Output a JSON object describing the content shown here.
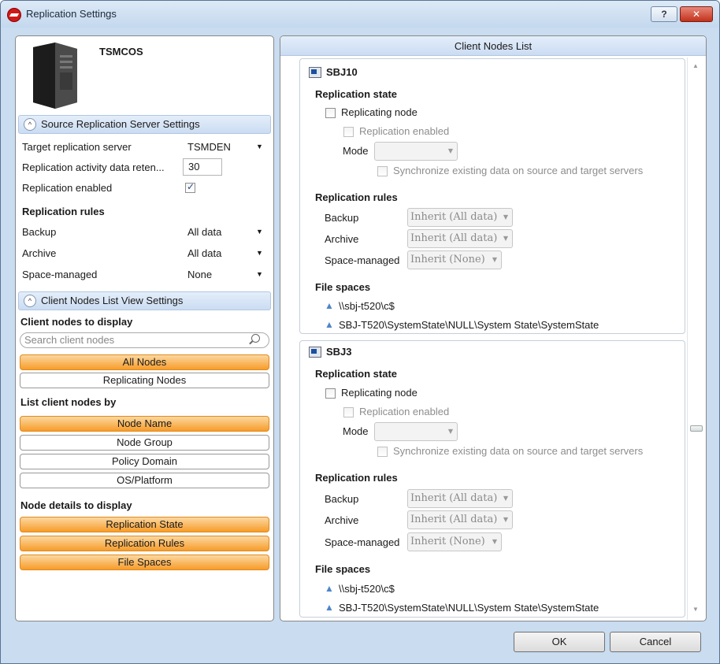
{
  "window": {
    "title": "Replication Settings",
    "help_label": "?",
    "close_label": "✕"
  },
  "left": {
    "server_name": "TSMCOS",
    "source_section": {
      "title": "Source Replication Server Settings",
      "chevron": "^"
    },
    "settings": {
      "target_label": "Target replication server",
      "target_value": "TSMDEN",
      "retention_label": "Replication activity data reten...",
      "retention_value": "30",
      "enabled_label": "Replication enabled",
      "enabled_checked": true
    },
    "rules": {
      "heading": "Replication rules",
      "backup_label": "Backup",
      "backup_value": "All data",
      "archive_label": "Archive",
      "archive_value": "All data",
      "space_label": "Space-managed",
      "space_value": "None"
    },
    "client_section": {
      "title": "Client Nodes List View Settings",
      "chevron": "^"
    },
    "display": {
      "heading": "Client nodes to display",
      "search_placeholder": "Search client nodes",
      "all_nodes": "All Nodes",
      "replicating_nodes": "Replicating Nodes"
    },
    "list_by": {
      "heading": "List client nodes by",
      "node_name": "Node Name",
      "node_group": "Node Group",
      "policy_domain": "Policy Domain",
      "os_platform": "OS/Platform"
    },
    "details": {
      "heading": "Node details to display",
      "replication_state": "Replication State",
      "replication_rules": "Replication Rules",
      "file_spaces": "File Spaces"
    },
    "dropdown_arrow": "▼"
  },
  "right": {
    "title": "Client Nodes List",
    "nodes": [
      {
        "name": "SBJ10",
        "state_heading": "Replication state",
        "replicating_node": "Replicating node",
        "replication_enabled": "Replication enabled",
        "mode_label": "Mode",
        "mode_value": "",
        "sync": "Synchronize existing data on source and target servers",
        "rules_heading": "Replication rules",
        "backup_label": "Backup",
        "backup_value": "Inherit (All data)",
        "archive_label": "Archive",
        "archive_value": "Inherit (All data)",
        "space_label": "Space-managed",
        "space_value": "Inherit (None)",
        "fs_heading": "File spaces",
        "file_spaces": [
          "\\\\sbj-t520\\c$",
          "SBJ-T520\\SystemState\\NULL\\System State\\SystemState"
        ]
      },
      {
        "name": "SBJ3",
        "state_heading": "Replication state",
        "replicating_node": "Replicating node",
        "replication_enabled": "Replication enabled",
        "mode_label": "Mode",
        "mode_value": "",
        "sync": "Synchronize existing data on source and target servers",
        "rules_heading": "Replication rules",
        "backup_label": "Backup",
        "backup_value": "Inherit (All data)",
        "archive_label": "Archive",
        "archive_value": "Inherit (All data)",
        "space_label": "Space-managed",
        "space_value": "Inherit (None)",
        "fs_heading": "File spaces",
        "file_spaces": [
          "\\\\sbj-t520\\c$",
          "SBJ-T520\\SystemState\\NULL\\System State\\SystemState"
        ]
      }
    ]
  },
  "buttons": {
    "ok": "OK",
    "cancel": "Cancel"
  },
  "colors": {
    "accent_orange": "#f79c2a",
    "section_blue": "#cbdcf2",
    "folder_blue": "#4d86c9"
  }
}
